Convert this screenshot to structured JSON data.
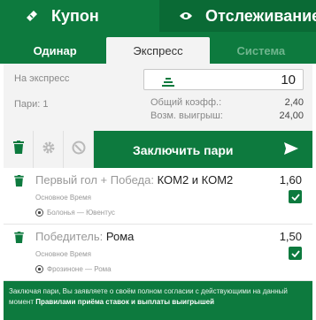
{
  "top_tabs": {
    "coupon": {
      "label": "Купон",
      "icon": "ticket-icon"
    },
    "tracking": {
      "label": "Отслеживание",
      "icon": "eye-icon"
    }
  },
  "sub_tabs": [
    "Одинар",
    "Экспресс",
    "Система"
  ],
  "active_sub_tab": "Экспресс",
  "express": {
    "label": "На экспресс",
    "stake": "10",
    "pairs_label": "Пари:",
    "pairs_count": "1",
    "total_coef_label": "Общий коэфф.:",
    "total_coef": "2,40",
    "possible_win_label": "Возм. выигрыш:",
    "possible_win": "24,00"
  },
  "actions": {
    "place_bet_label": "Заключить пари",
    "icons": [
      "trash-icon",
      "gear-icon",
      "no-entry-icon",
      "send-arrow-icon"
    ]
  },
  "bets": [
    {
      "market": "Первый гол + Победа: ",
      "pick": "КОМ2 и КОМ2",
      "odd": "1,60",
      "period": "Основное Время",
      "event": "Болонья — Ювентус",
      "checked": true
    },
    {
      "market": "Победитель: ",
      "pick": "Рома",
      "odd": "1,50",
      "period": "Основное Время",
      "event": "Фрозиноне — Рома",
      "checked": true
    }
  ],
  "footer": {
    "text": "Заключая пари, Вы заявляете о своём полном согласии с действующими на данный момент",
    "link": "Правилами приёма ставок и выплаты выигрышей"
  },
  "colors": {
    "primary_green": "#0d7a3e",
    "dark_green": "#0a6a35",
    "panel_bg": "#f3f3f3"
  }
}
